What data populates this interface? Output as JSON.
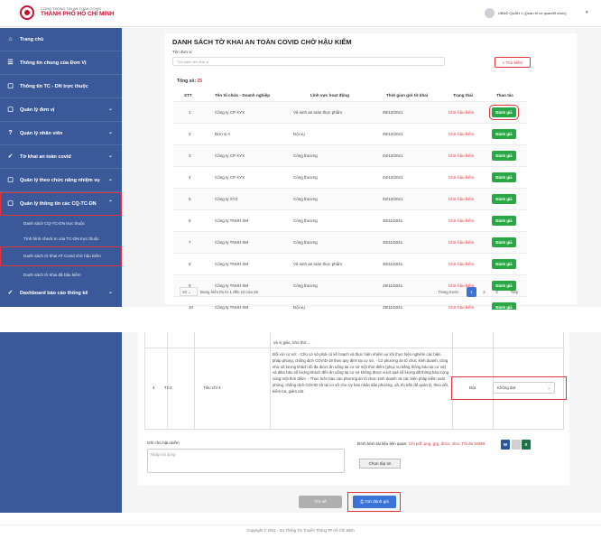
{
  "header": {
    "org_line1": "CỔNG THÔNG TIN AN TOÀN COVID",
    "org_line2": "THÀNH PHỐ HỒ CHÍ MINH",
    "user": "UBND QUẬN 1 (Quản trị cơ quan/tổ chức)"
  },
  "sidebar": {
    "items": [
      {
        "label": "Trang chủ",
        "icon": "home-icon"
      },
      {
        "label": "Thông tin chung của Đơn Vị",
        "icon": "list-icon"
      },
      {
        "label": "Thông tin TC - DN trực thuộc",
        "icon": "document-icon"
      },
      {
        "label": "Quản lý đơn vị",
        "icon": "document-icon"
      },
      {
        "label": "Quản lý nhân viên",
        "icon": "help-icon"
      },
      {
        "label": "Tờ khai an toàn covid",
        "icon": "check-icon"
      },
      {
        "label": "Quản lý theo chức năng nhiệm vụ",
        "icon": "document-icon"
      },
      {
        "label": "Quản lý thông tin các CQ-TC-DN",
        "icon": "document-icon"
      }
    ],
    "sub_items": [
      "Danh sách CQ-TC-DN trực thuộc",
      "Tình hình check in của TC-DN trực thuộc",
      "Danh sách tờ khai AT Covid chờ hậu kiểm",
      "Danh sách tờ khai đã hậu kiểm"
    ],
    "last_item": "Dashboard báo cáo thống kê"
  },
  "page": {
    "title": "DANH SÁCH TỜ KHAI AN TOÀN COVID CHỜ HẬU KIỂM",
    "filter_label": "Tên đơn vị",
    "filter_placeholder": "Tìm kiếm tên đơn vị",
    "search_button": "Tìm kiếm",
    "total_label": "Tổng số:",
    "total_value": "25"
  },
  "table": {
    "columns": [
      "STT",
      "Tên tổ chức - Doanh nghiệp",
      "Lĩnh vực hoạt động",
      "Thời gian gửi tờ khai",
      "Trạng thái",
      "Thao tác"
    ],
    "action_label": "Đánh giá",
    "rows": [
      {
        "stt": "1",
        "name": "Công ty CP XYX",
        "field": "Vệ sinh an toàn thực phẩm",
        "date": "09/12/2021",
        "status": "Chờ hậu kiểm"
      },
      {
        "stt": "2",
        "name": "Đơn vị A",
        "field": "Nội vụ",
        "date": "09/12/2021",
        "status": "Chờ hậu kiểm"
      },
      {
        "stt": "3",
        "name": "Công ty CP XYX",
        "field": "Công thương",
        "date": "04/12/2021",
        "status": "Chờ hậu kiểm"
      },
      {
        "stt": "4",
        "name": "Công ty CP XYX",
        "field": "Công thương",
        "date": "04/12/2021",
        "status": "Chờ hậu kiểm"
      },
      {
        "stt": "5",
        "name": "Công ty XYZ",
        "field": "Công thương",
        "date": "02/12/2021",
        "status": "Chờ hậu kiểm"
      },
      {
        "stt": "6",
        "name": "Công ty TNHH SM",
        "field": "Công thương",
        "date": "30/11/2021",
        "status": "Chờ hậu kiểm"
      },
      {
        "stt": "7",
        "name": "Công ty TNHH SM",
        "field": "Công thương",
        "date": "30/11/2021",
        "status": "Chờ hậu kiểm"
      },
      {
        "stt": "8",
        "name": "Công ty TNHH SM",
        "field": "Vệ sinh an toàn thực phẩm",
        "date": "30/11/2021",
        "status": "Chờ hậu kiểm"
      },
      {
        "stt": "9",
        "name": "Công ty TNHH SM",
        "field": "Công thương",
        "date": "29/11/2021",
        "status": "Chờ hậu kiểm"
      },
      {
        "stt": "10",
        "name": "Công ty TNHH SM",
        "field": "Nội vụ",
        "date": "29/11/2021",
        "status": "Chờ hậu kiểm"
      }
    ]
  },
  "pagination": {
    "page_size": "10",
    "info": "Đang hiển thị từ 1 đến 10 của 25",
    "prev": "Trang trước",
    "pages": [
      "1",
      "2",
      "3"
    ],
    "next": "Tiếp"
  },
  "detail": {
    "prev_text": "và vị giác, khó thở,...",
    "row_index": "4",
    "code": "TC4",
    "criterion": "Tiêu chí 4",
    "description": "Đối với cơ sở: - Chủ cơ sở phải có kế hoạch và thực hiện nhiệm vụ khi thực hiện nghiêm các biện pháp phòng, chống dịch COVID-19 theo quy định tại cơ sở. - Có phương án tổ chức kinh doanh, cũng như số lượng khách tối đa được ăn uống tại cơ sở một thời điểm (phục vụ bằng thông báo tại cơ sở) và đảm bảo số lượng khách đến ăn uống tại cơ sở không được vượt quá số lượng đã thông báo trong cùng một thời điểm. - Thực hiện báo cáo phương án tổ chức kinh doanh và các biện pháp kiểm soát phòng, chống dịch COVID-19 tại cơ sở cho Ủy ban nhân dân phường, xã, thị trấn để quản lý, theo dõi, kiểm tra, giám sát.",
    "result": "Đạt",
    "select_value": "Không đạt",
    "note_label": "Ghi chú hậu kiểm",
    "note_placeholder": "Nhập nội dung",
    "attach_label": "Đính kèm tài liệu liên quan:",
    "attach_hint": "Chỉ pdf, png, jpg, docx, xlsx. Tối đa 50MB",
    "choose_file": "Chọn tệp tin",
    "back_button": "Trở về",
    "submit_button": "Gửi đánh giá",
    "footer": "Copyright © 2021 - Sở Thông Tin Truyền Thông TP Hồ Chí Minh"
  },
  "colors": {
    "sidebar": "#3b5998",
    "accent_red": "#e0363b",
    "green": "#28a745",
    "blue": "#3b73d8"
  }
}
